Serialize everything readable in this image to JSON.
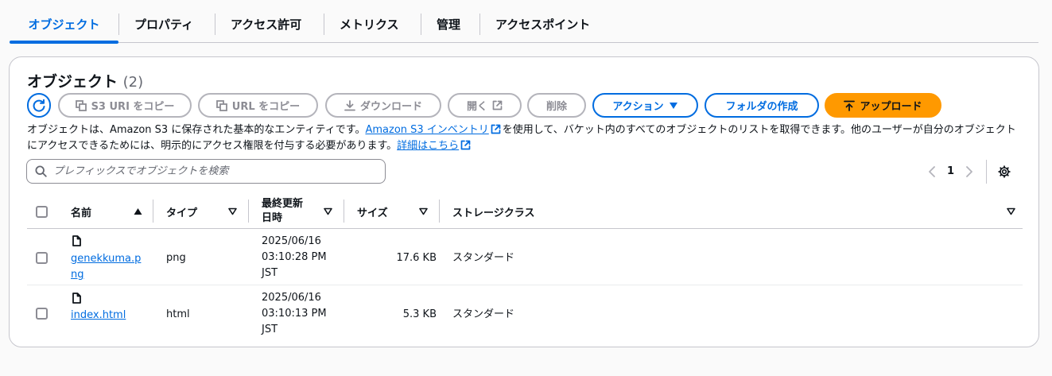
{
  "tabs": [
    {
      "label": "オブジェクト",
      "active": true
    },
    {
      "label": "プロパティ"
    },
    {
      "label": "アクセス許可"
    },
    {
      "label": "メトリクス"
    },
    {
      "label": "管理"
    },
    {
      "label": "アクセスポイント"
    }
  ],
  "objects": {
    "title": "オブジェクト",
    "count": "(2)",
    "buttons": {
      "copy_s3_uri": "S3 URI をコピー",
      "copy_url": "URL をコピー",
      "download": "ダウンロード",
      "open": "開く",
      "delete": "削除",
      "actions": "アクション",
      "create_folder": "フォルダの作成",
      "upload": "アップロード"
    },
    "description": {
      "part1": "オブジェクトは、Amazon S3 に保存された基本的なエンティティです。",
      "link1": "Amazon S3 インベントリ",
      "part2": "を使用して、バケット内のすべてのオブジェクトのリストを取得できます。他のユーザーが自分のオブジェクトにアクセスできるためには、明示的にアクセス権限を付与する必要があります。",
      "link2": "詳細はこちら"
    },
    "search_placeholder": "プレフィックスでオブジェクトを検索",
    "page": "1",
    "columns": {
      "name": "名前",
      "type": "タイプ",
      "modified_line1": "最終更新",
      "modified_line2": "日時",
      "size": "サイズ",
      "storage_class": "ストレージクラス"
    },
    "rows": [
      {
        "name_line1": "genekkuma.p",
        "name_line2": "ng",
        "type": "png",
        "date": "2025/06/16",
        "time": "03:10:28 PM",
        "tz": "JST",
        "size": "17.6 KB",
        "storage_class": "スタンダード"
      },
      {
        "name_line1": "index.html",
        "name_line2": "",
        "type": "html",
        "date": "2025/06/16",
        "time": "03:10:13 PM",
        "tz": "JST",
        "size": "5.3 KB",
        "storage_class": "スタンダード"
      }
    ]
  },
  "colors": {
    "accent": "#006ce0",
    "upload": "#ff9900",
    "border": "#c6c6cd",
    "disabled": "#8c8c94"
  }
}
